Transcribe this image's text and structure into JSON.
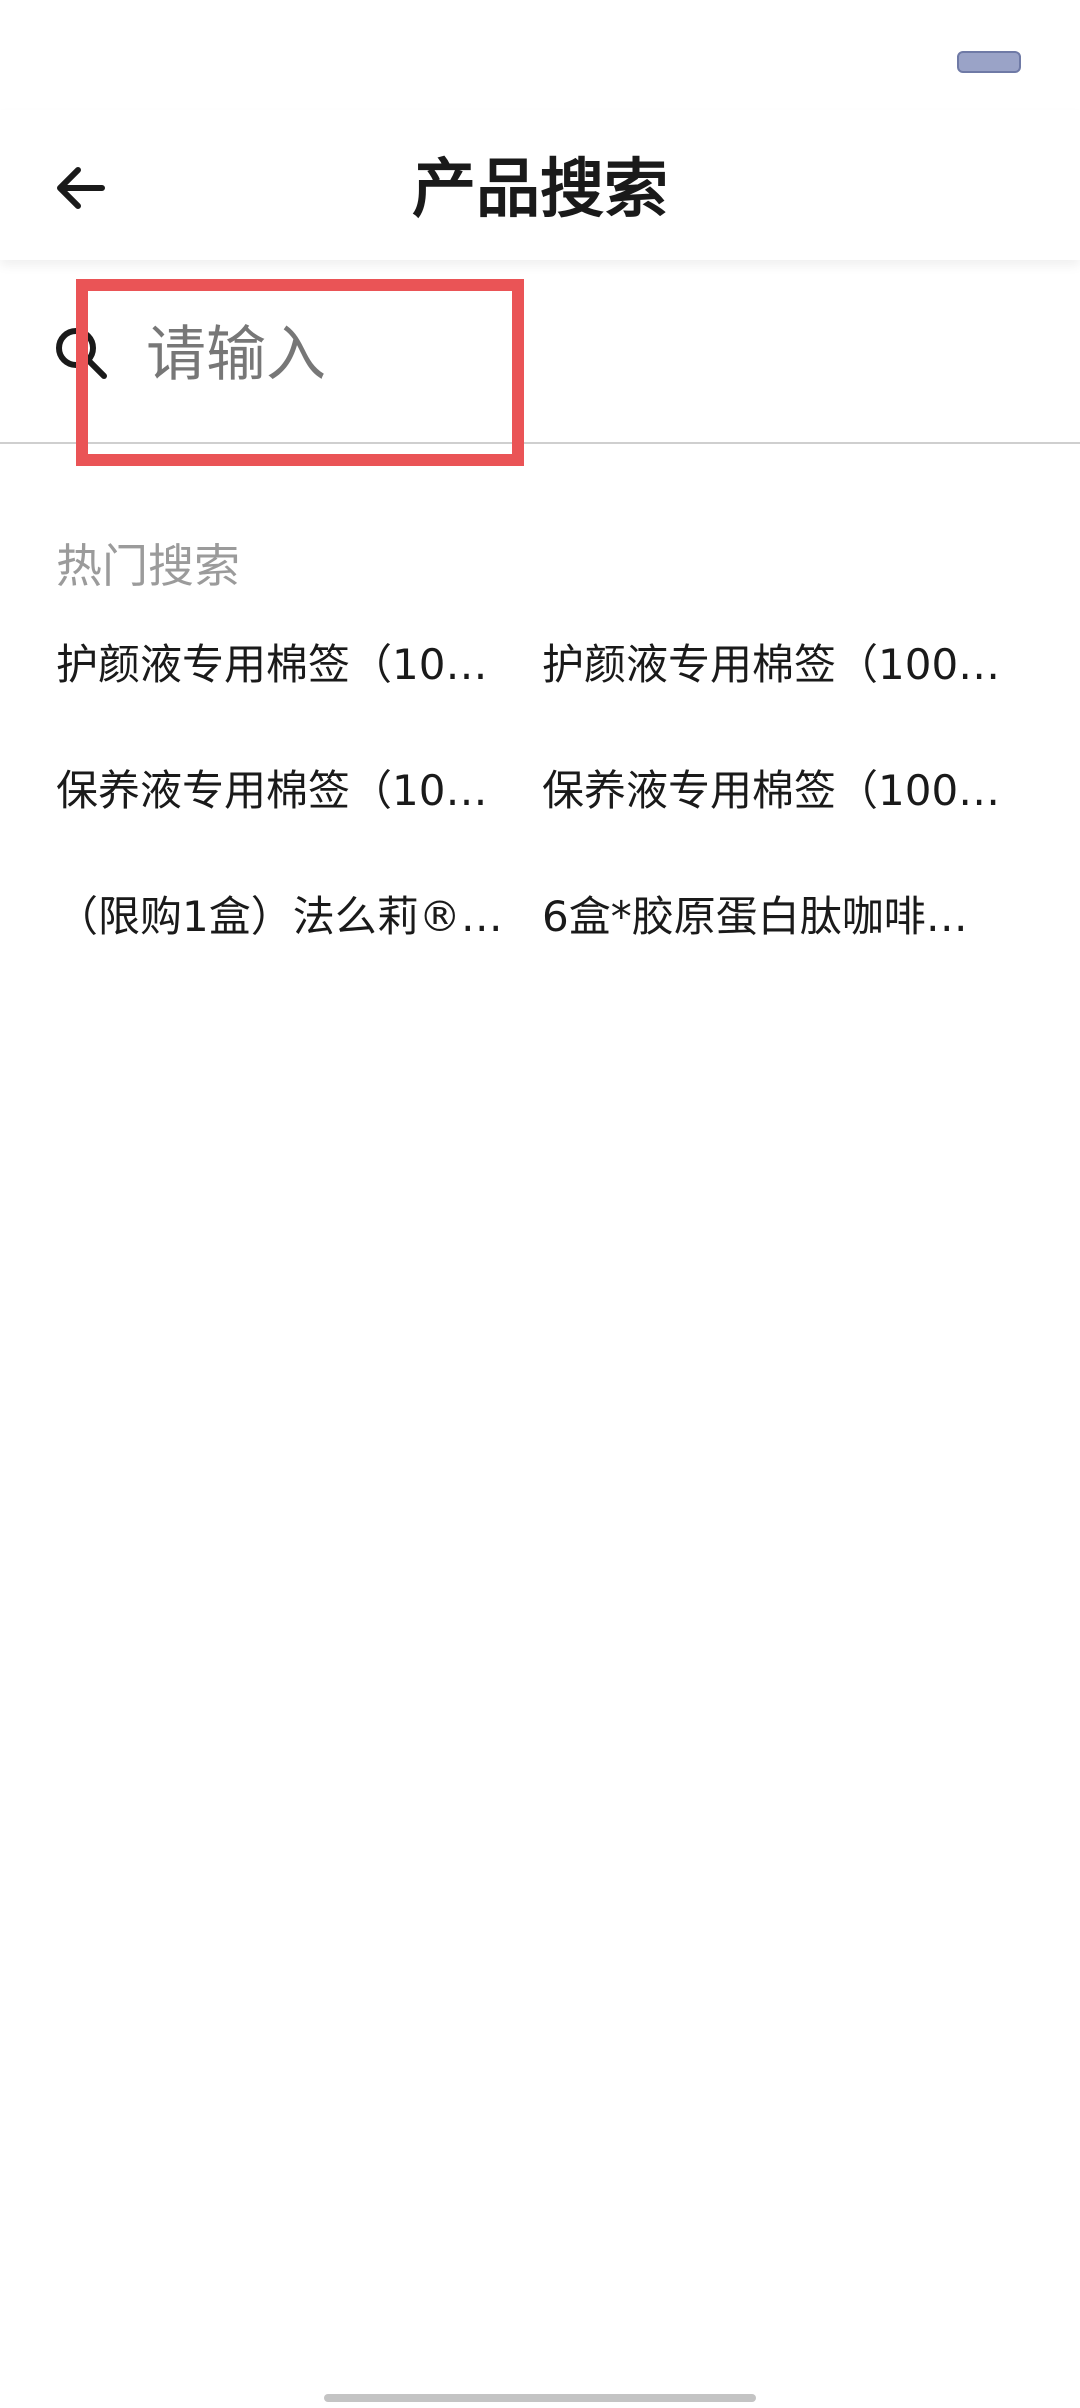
{
  "header": {
    "title": "产品搜索",
    "back_icon": "arrow-left-icon"
  },
  "search": {
    "icon": "search-icon",
    "placeholder": "请输入",
    "value": ""
  },
  "hot_search": {
    "title": "热门搜索",
    "items": [
      "护颜液专用棉签（10…",
      "护颜液专用棉签（100…",
      "保养液专用棉签（10…",
      "保养液专用棉签（100…",
      "（限购1盒）法么莉®…",
      "6盒*胶原蛋白肽咖啡…"
    ]
  },
  "colors": {
    "highlight": "#ea5456",
    "hint_text": "#9b9b9b",
    "divider": "#cfcfcf"
  }
}
